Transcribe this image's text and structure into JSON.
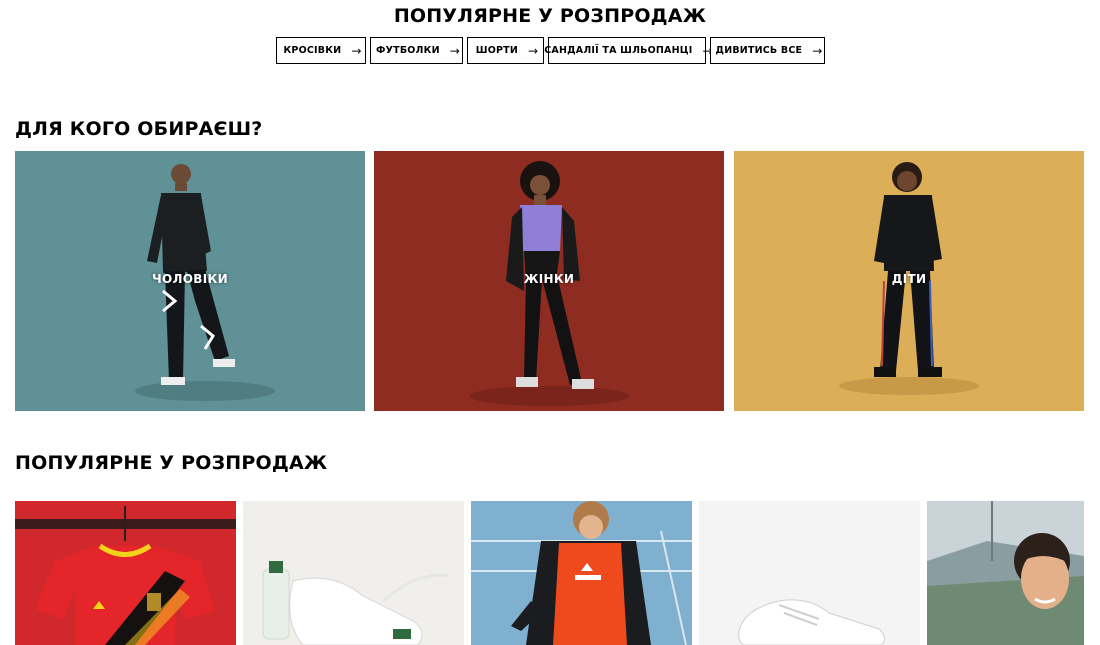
{
  "top_section": {
    "title": "ПОПУЛЯРНЕ У РОЗПРОДАЖ",
    "pills": [
      {
        "label": "КРОСІВКИ",
        "arrow": "→"
      },
      {
        "label": "ФУТБОЛКИ",
        "arrow": "→"
      },
      {
        "label": "ШОРТИ",
        "arrow": "→"
      },
      {
        "label": "САНДАЛІЇ ТА ШЛЬОПАНЦІ",
        "arrow": "→"
      },
      {
        "label": "ДИВИТИСЬ ВСЕ",
        "arrow": "→"
      }
    ]
  },
  "categories": {
    "title": "ДЛЯ КОГО ОБИРАЄШ?",
    "items": [
      {
        "label": "ЧОЛОВІКИ",
        "background": "#5f9196"
      },
      {
        "label": "ЖІНКИ",
        "background": "#8e2c22"
      },
      {
        "label": "ДІТИ",
        "background": "#dcae58"
      }
    ]
  },
  "sale": {
    "title": "ПОПУЛЯРНЕ У РОЗПРОДАЖ",
    "products": [
      {
        "image": "red-football-jersey",
        "background": "#d0282c"
      },
      {
        "image": "white-sneaker-bottle",
        "background": "#f1efec"
      },
      {
        "image": "kid-orange-tshirt",
        "background": "#7fb0cf"
      },
      {
        "image": "white-sneaker",
        "background": "#f4f4f4"
      },
      {
        "image": "woman-stadium",
        "background": "#9fb0a5"
      }
    ]
  }
}
